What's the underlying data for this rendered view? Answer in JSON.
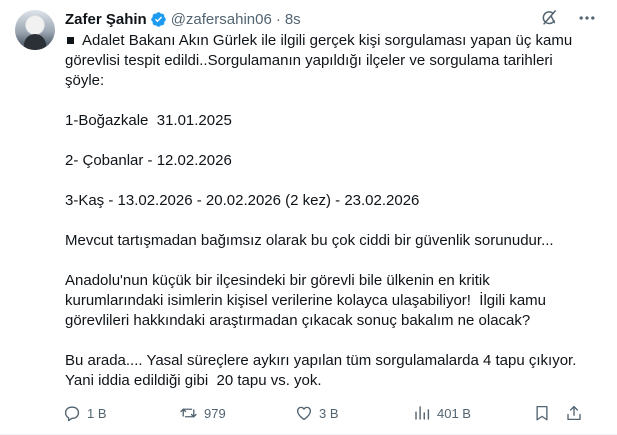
{
  "tweet": {
    "author_name": "Zafer Şahin",
    "handle": "@zafersahin06",
    "separator": "·",
    "time": "8s",
    "paragraphs": [
      "Adalet Bakanı Akın Gürlek ile ilgili gerçek kişi sorgulaması yapan üç kamu görevlisi tespit edildi..Sorgulamanın yapıldığı ilçeler ve sorgulama tarihleri şöyle:",
      "1-Boğazkale  31.01.2025",
      "2- Çobanlar - 12.02.2026",
      "3-Kaş - 13.02.2026 - 20.02.2026 (2 kez) - 23.02.2026",
      "Mevcut tartışmadan bağımsız olarak bu çok ciddi bir güvenlik sorunudur...",
      "Anadolu'nun küçük bir ilçesindeki bir görevli bile ülkenin en kritik kurumlarındaki isimlerin kişisel verilerine kolayca ulaşabiliyor!  İlgili kamu görevlileri hakkındaki araştırmadan çıkacak sonuç bakalım ne olacak?",
      "Bu arada.... Yasal süreçlere aykırı yapılan tüm sorgulamalarda 4 tapu çıkıyor. Yani iddia edildiği gibi  20 tapu vs. yok."
    ]
  },
  "actions": {
    "replies": "1 B",
    "reposts": "979",
    "likes": "3 B",
    "views": "401 B"
  },
  "icons": {
    "verified": "verified-badge-icon",
    "grok": "grok-icon",
    "more": "more-icon",
    "reply": "reply-icon",
    "repost": "repost-icon",
    "like": "heart-icon",
    "views": "views-icon",
    "bookmark": "bookmark-icon",
    "share": "share-icon"
  },
  "colors": {
    "verified": "#1d9bf0",
    "secondary_text": "#536471",
    "primary_text": "#0f1419"
  }
}
